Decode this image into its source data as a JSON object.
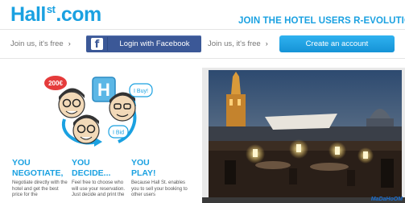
{
  "brand": {
    "logo_prefix": "Hall",
    "logo_sup": "st",
    "logo_suffix": ".com"
  },
  "header": {
    "slogan": "JOIN THE HOTEL USERS R-EVOLUTION!"
  },
  "signup": {
    "join_left": "Join us, it's free",
    "join_right": "Join us, it's free",
    "facebook_label": "Login with Facebook",
    "create_label": "Create an account"
  },
  "illustration": {
    "bubble_left": "200€",
    "bubble_right": "I Buy!",
    "bubble_bottom": "I Bid"
  },
  "features": [
    {
      "title_1": "YOU",
      "title_2": "NEGOTIATE,",
      "desc": "Negotiate directly with the hotel and get the best price for the"
    },
    {
      "title_1": "YOU",
      "title_2": "DECIDE...",
      "desc": "Feel free to choose who will use your reservation. Just decide and print the"
    },
    {
      "title_1": "YOU",
      "title_2": "PLAY!",
      "desc": "Because Hall St. enables you to sell your booking to other users"
    }
  ],
  "watermark": "MaDaHoOM",
  "colors": {
    "brand_blue": "#1aa1e1",
    "facebook_blue": "#3b5897",
    "button_blue": "#1a9ce0",
    "bid_red": "#e53b3b"
  },
  "icons": {
    "facebook": "facebook-f-icon",
    "arrows": "chevron-right-icon"
  }
}
